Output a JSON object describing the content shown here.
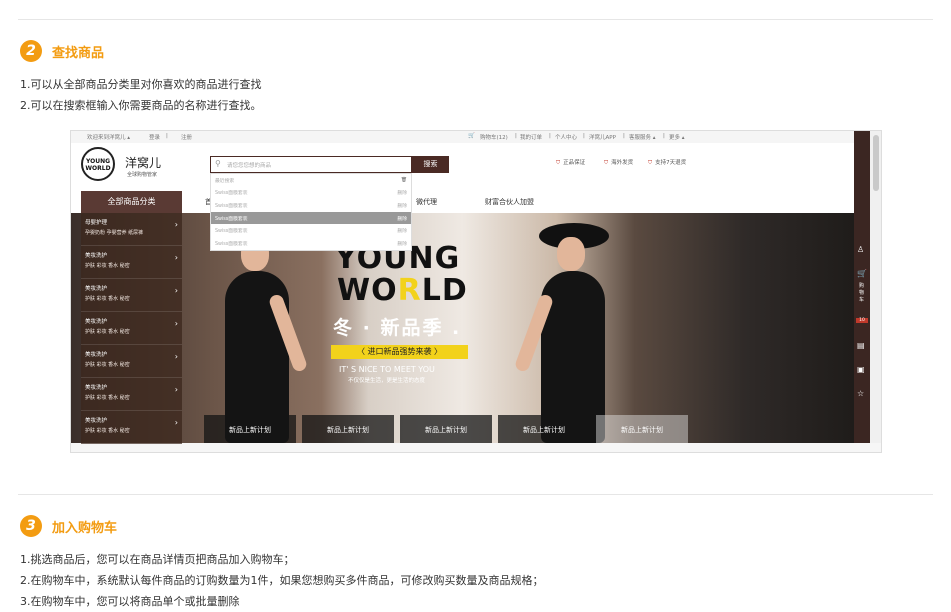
{
  "section2": {
    "number": "2",
    "title": "查找商品",
    "lines": [
      "1.可以从全部商品分类里对你喜欢的商品进行查找",
      "2.可以在搜索框输入你需要商品的名称进行查找。"
    ]
  },
  "shot": {
    "topbar": {
      "welcome": "欢迎来到洋窝儿 ▴",
      "login": "登录",
      "register": "注册",
      "cart": "购物车(12)",
      "orders": "我的订单",
      "account": "个人中心",
      "app": "洋窝儿APP",
      "service": "客服服务 ▴",
      "more": "更多 ▴"
    },
    "logo": {
      "circle_top": "YOUNG",
      "circle_bottom": "WORLD",
      "name": "洋窝儿",
      "sub": "全球购物管家"
    },
    "search": {
      "placeholder": "请您您您想的商品",
      "button": "搜索"
    },
    "guarantees": [
      "正品保证",
      "海外发货",
      "支持7天退货"
    ],
    "dropdown": {
      "header": "最近搜索",
      "items": [
        {
          "text": "Swiss面膜套装",
          "action": "删除"
        },
        {
          "text": "Swiss面膜套装",
          "action": "删除"
        },
        {
          "text": "Swiss面膜套装",
          "action": "删除"
        },
        {
          "text": "Swiss面膜套装",
          "action": "删除"
        },
        {
          "text": "Swiss面膜套装",
          "action": "删除"
        }
      ]
    },
    "nav": {
      "all_categories": "全部商品分类",
      "partial": "首",
      "micro_agent": "微代理",
      "partner": "财富合伙人加盟"
    },
    "categories": [
      {
        "name": "母婴护理",
        "subs": "孕婴奶粉  孕婴营养  纸尿裤"
      },
      {
        "name": "美妆洗护",
        "subs": "护肤  彩妆  香水  秘密"
      },
      {
        "name": "美妆洗护",
        "subs": "护肤  彩妆  香水  秘密"
      },
      {
        "name": "美妆洗护",
        "subs": "护肤  彩妆  香水  秘密"
      },
      {
        "name": "美妆洗护",
        "subs": "护肤  彩妆  香水  秘密"
      },
      {
        "name": "美妆洗护",
        "subs": "护肤  彩妆  香水  秘密"
      },
      {
        "name": "美妆洗护",
        "subs": "护肤  彩妆  香水  秘密"
      }
    ],
    "banner": {
      "line1": "YOUNG",
      "line2_a": "WO",
      "line2_b": "R",
      "line2_c": "LD",
      "season": "冬 · 新品季 .",
      "tag": "〈  进口新品强势来袭  〉",
      "english": "IT' S NICE TO MEET YOU",
      "chinese": "不仅仅是生活，更是生活的态度",
      "tabs": [
        "新品上新计划",
        "新品上新计划",
        "新品上新计划",
        "新品上新计划",
        "新品上新计划"
      ]
    },
    "rail": {
      "cart": "购物车",
      "count": "10"
    }
  },
  "section3": {
    "number": "3",
    "title": "加入购物车",
    "lines": [
      "1.挑选商品后，您可以在商品详情页把商品加入购物车；",
      "2.在购物车中，系统默认每件商品的订购数量为1件，如果您想购买多件商品，可修改购买数量及商品规格；",
      "3.在购物车中，您可以将商品单个或批量删除"
    ]
  },
  "colors": {
    "accent": "#f39c12",
    "brand_dark": "#4a2a24",
    "banner_yellow": "#f2d21b"
  }
}
